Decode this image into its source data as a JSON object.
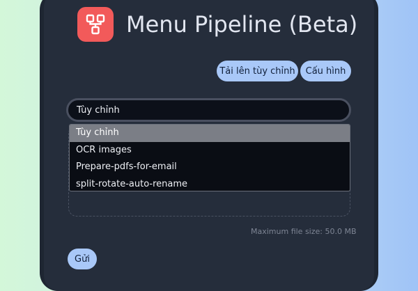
{
  "header": {
    "title": "Menu Pipeline (Beta)",
    "logo_icon": "pipeline-flow-icon",
    "logo_color": "#f25a5a"
  },
  "actions": {
    "upload_label": "Tải lên tùy chỉnh",
    "config_label": "Cấu hình"
  },
  "pipeline_select": {
    "value": "Tùy chỉnh",
    "options": [
      "Tùy chỉnh",
      "OCR images",
      "Prepare-pdfs-for-email",
      "split-rotate-auto-rename"
    ],
    "selected_index": 0
  },
  "upload": {
    "max_size_text": "Maximum file size: 50.0 MB"
  },
  "submit": {
    "label": "Gửi"
  },
  "colors": {
    "accent": "#a9c8f8",
    "card": "#252d3b",
    "logo": "#f25a5a"
  }
}
